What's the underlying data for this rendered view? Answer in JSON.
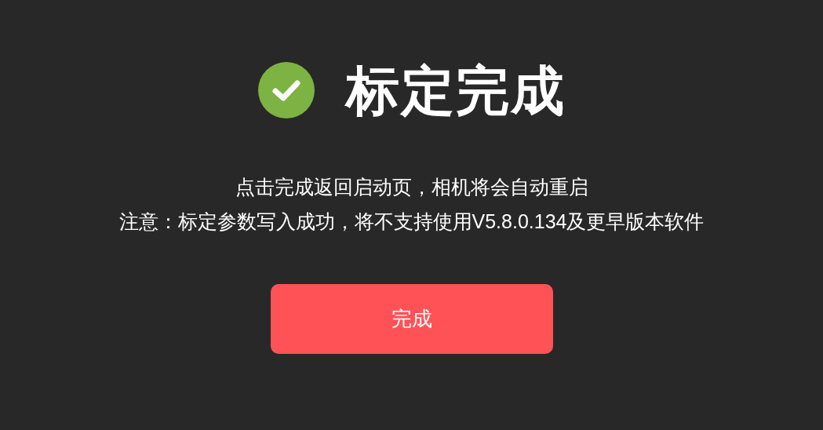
{
  "header": {
    "title": "标定完成",
    "success": true
  },
  "messages": [
    "点击完成返回启动页，相机将会自动重启",
    "注意：标定参数写入成功，将不支持使用V5.8.0.134及更早版本软件"
  ],
  "button": {
    "label": "完成"
  }
}
